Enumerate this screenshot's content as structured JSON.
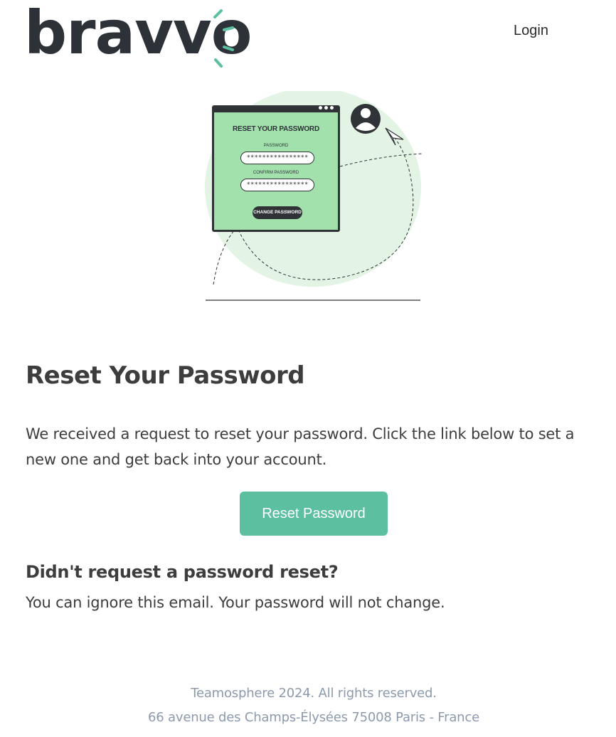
{
  "header": {
    "logo_text": "bravvo",
    "login_label": "Login"
  },
  "illustration": {
    "title": "RESET YOUR PASSWORD",
    "password_label": "PASSWORD",
    "password_value": "****************",
    "confirm_label": "CONFIRM PASSWORD",
    "confirm_value": "****************",
    "button_label": "CHANGE PASSWORD"
  },
  "main": {
    "heading": "Reset Your Password",
    "intro": "We received a request to reset your password. Click the link below to set a new one and get back into your account.",
    "reset_button_label": "Reset Password",
    "subheading": "Didn't request a password reset?",
    "ignore_text": "You can ignore this email. Your password will not change."
  },
  "footer": {
    "copyright": "Teamosphere 2024. All rights reserved.",
    "address": "66 avenue des Champs-Élysées 75008 Paris - France"
  },
  "colors": {
    "accent": "#5cbfa0",
    "text": "#3d3d3d",
    "footer_text": "#8c9aac",
    "illustration_green": "#a3e1ac",
    "illustration_blob": "#e3f4e4"
  }
}
